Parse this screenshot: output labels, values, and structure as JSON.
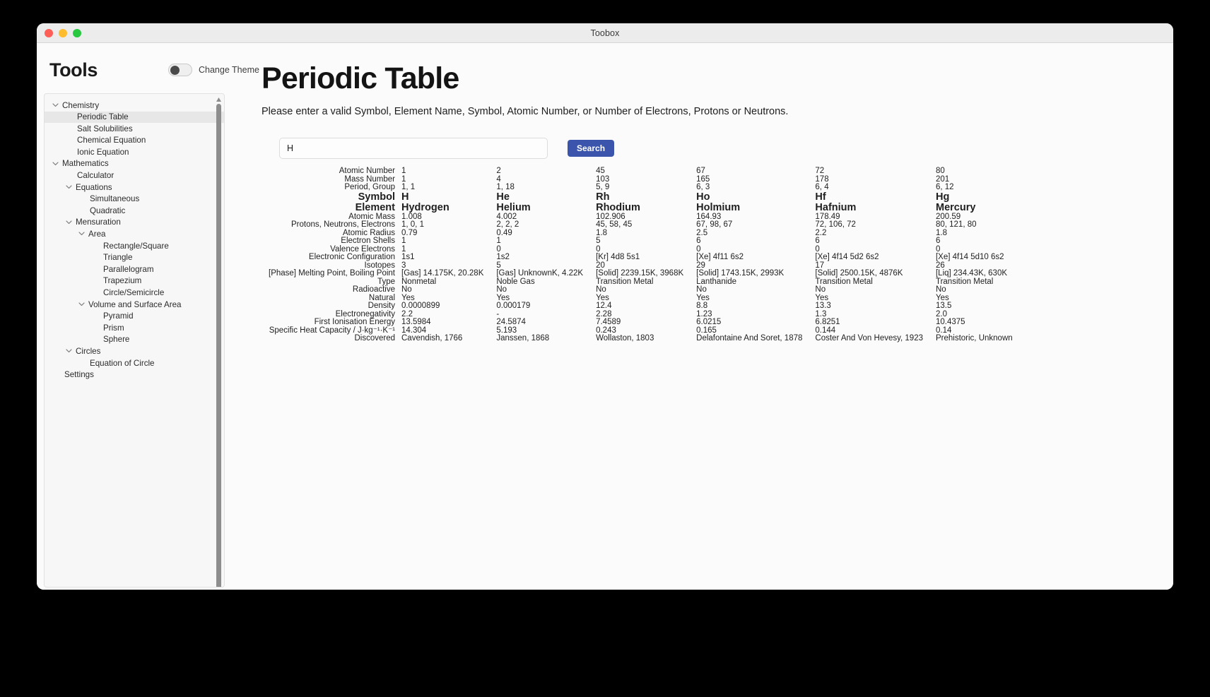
{
  "window": {
    "title": "Toobox"
  },
  "sidebar": {
    "heading": "Tools",
    "theme_label": "Change Theme",
    "tree": [
      {
        "label": "Chemistry",
        "depth": 0,
        "chevron": true,
        "selected": false
      },
      {
        "label": "Periodic Table",
        "depth": 1,
        "chevron": false,
        "selected": true
      },
      {
        "label": "Salt Solubilities",
        "depth": 1,
        "chevron": false,
        "selected": false
      },
      {
        "label": "Chemical Equation",
        "depth": 1,
        "chevron": false,
        "selected": false
      },
      {
        "label": "Ionic Equation",
        "depth": 1,
        "chevron": false,
        "selected": false
      },
      {
        "label": "Mathematics",
        "depth": 0,
        "chevron": true,
        "selected": false
      },
      {
        "label": "Calculator",
        "depth": 1,
        "chevron": false,
        "selected": false
      },
      {
        "label": "Equations",
        "depth": 1,
        "chevron": true,
        "selected": false
      },
      {
        "label": "Simultaneous",
        "depth": 2,
        "chevron": false,
        "selected": false
      },
      {
        "label": "Quadratic",
        "depth": 2,
        "chevron": false,
        "selected": false
      },
      {
        "label": "Mensuration",
        "depth": 1,
        "chevron": true,
        "selected": false
      },
      {
        "label": "Area",
        "depth": 2,
        "chevron": true,
        "selected": false
      },
      {
        "label": "Rectangle/Square",
        "depth": 3,
        "chevron": false,
        "selected": false
      },
      {
        "label": "Triangle",
        "depth": 3,
        "chevron": false,
        "selected": false
      },
      {
        "label": "Parallelogram",
        "depth": 3,
        "chevron": false,
        "selected": false
      },
      {
        "label": "Trapezium",
        "depth": 3,
        "chevron": false,
        "selected": false
      },
      {
        "label": "Circle/Semicircle",
        "depth": 3,
        "chevron": false,
        "selected": false
      },
      {
        "label": "Volume and Surface Area",
        "depth": 2,
        "chevron": true,
        "selected": false
      },
      {
        "label": "Pyramid",
        "depth": 3,
        "chevron": false,
        "selected": false
      },
      {
        "label": "Prism",
        "depth": 3,
        "chevron": false,
        "selected": false
      },
      {
        "label": "Sphere",
        "depth": 3,
        "chevron": false,
        "selected": false
      },
      {
        "label": "Circles",
        "depth": 1,
        "chevron": true,
        "selected": false
      },
      {
        "label": "Equation of Circle",
        "depth": 2,
        "chevron": false,
        "selected": false
      },
      {
        "label": "Settings",
        "depth": 0,
        "chevron": false,
        "selected": false
      }
    ]
  },
  "main": {
    "title": "Periodic Table",
    "subtitle": "Please enter a valid Symbol, Element Name, Symbol, Atomic Number, or Number of Electrons, Protons or Neutrons.",
    "search_value": "H",
    "search_placeholder": "",
    "search_button": "Search",
    "accent_color": "#3b55ad"
  },
  "table": {
    "row_labels": [
      "Atomic Number",
      "Mass Number",
      "Period, Group",
      "Symbol",
      "Element",
      "Atomic Mass",
      "Protons, Neutrons, Electrons",
      "Atomic Radius",
      "Electron Shells",
      "Valence Electrons",
      "Electronic Configuration",
      "Isotopes",
      "[Phase] Melting Point, Boiling Point",
      "Type",
      "Radioactive",
      "Natural",
      "Density",
      "Electronegativity",
      "First Ionisation Energy",
      "Specific Heat Capacity / J·kg⁻¹·K⁻¹",
      "Discovered"
    ],
    "big_rows": [
      3,
      4
    ],
    "columns": [
      {
        "atomic_number": "1",
        "mass_number": "1",
        "period_group": "1, 1",
        "symbol": "H",
        "element": "Hydrogen",
        "atomic_mass": "1.008",
        "pne": "1, 0, 1",
        "atomic_radius": "0.79",
        "electron_shells": "1",
        "valence_electrons": "1",
        "configuration": "1s1",
        "isotopes": "3",
        "phase_points": "[Gas] 14.175K, 20.28K",
        "type": "Nonmetal",
        "radioactive": "No",
        "natural": "Yes",
        "density": "0.0000899",
        "electronegativity": "2.2",
        "first_ionisation": "13.5984",
        "specific_heat": "14.304",
        "discovered": "Cavendish, 1766"
      },
      {
        "atomic_number": "2",
        "mass_number": "4",
        "period_group": "1, 18",
        "symbol": "He",
        "element": "Helium",
        "atomic_mass": "4.002",
        "pne": "2, 2, 2",
        "atomic_radius": "0.49",
        "electron_shells": "1",
        "valence_electrons": "0",
        "configuration": "1s2",
        "isotopes": "5",
        "phase_points": "[Gas] UnknownK, 4.22K",
        "type": "Noble Gas",
        "radioactive": "No",
        "natural": "Yes",
        "density": "0.000179",
        "electronegativity": "-",
        "first_ionisation": "24.5874",
        "specific_heat": "5.193",
        "discovered": "Janssen, 1868"
      },
      {
        "atomic_number": "45",
        "mass_number": "103",
        "period_group": "5, 9",
        "symbol": "Rh",
        "element": "Rhodium",
        "atomic_mass": "102.906",
        "pne": "45, 58, 45",
        "atomic_radius": "1.8",
        "electron_shells": "5",
        "valence_electrons": "0",
        "configuration": "[Kr] 4d8 5s1",
        "isotopes": "20",
        "phase_points": "[Solid] 2239.15K, 3968K",
        "type": "Transition Metal",
        "radioactive": "No",
        "natural": "Yes",
        "density": "12.4",
        "electronegativity": "2.28",
        "first_ionisation": "7.4589",
        "specific_heat": "0.243",
        "discovered": "Wollaston, 1803"
      },
      {
        "atomic_number": "67",
        "mass_number": "165",
        "period_group": "6, 3",
        "symbol": "Ho",
        "element": "Holmium",
        "atomic_mass": "164.93",
        "pne": "67, 98, 67",
        "atomic_radius": "2.5",
        "electron_shells": "6",
        "valence_electrons": "0",
        "configuration": "[Xe] 4f11 6s2",
        "isotopes": "29",
        "phase_points": "[Solid] 1743.15K, 2993K",
        "type": "Lanthanide",
        "radioactive": "No",
        "natural": "Yes",
        "density": "8.8",
        "electronegativity": "1.23",
        "first_ionisation": "6.0215",
        "specific_heat": "0.165",
        "discovered": "Delafontaine And Soret, 1878"
      },
      {
        "atomic_number": "72",
        "mass_number": "178",
        "period_group": "6, 4",
        "symbol": "Hf",
        "element": "Hafnium",
        "atomic_mass": "178.49",
        "pne": "72, 106, 72",
        "atomic_radius": "2.2",
        "electron_shells": "6",
        "valence_electrons": "0",
        "configuration": "[Xe] 4f14 5d2 6s2",
        "isotopes": "17",
        "phase_points": "[Solid] 2500.15K, 4876K",
        "type": "Transition Metal",
        "radioactive": "No",
        "natural": "Yes",
        "density": "13.3",
        "electronegativity": "1.3",
        "first_ionisation": "6.8251",
        "specific_heat": "0.144",
        "discovered": "Coster And Von Hevesy, 1923"
      },
      {
        "atomic_number": "80",
        "mass_number": "201",
        "period_group": "6, 12",
        "symbol": "Hg",
        "element": "Mercury",
        "atomic_mass": "200.59",
        "pne": "80, 121, 80",
        "atomic_radius": "1.8",
        "electron_shells": "6",
        "valence_electrons": "0",
        "configuration": "[Xe] 4f14 5d10 6s2",
        "isotopes": "26",
        "phase_points": "[Liq] 234.43K, 630K",
        "type": "Transition Metal",
        "radioactive": "No",
        "natural": "Yes",
        "density": "13.5",
        "electronegativity": "2.0",
        "first_ionisation": "10.4375",
        "specific_heat": "0.14",
        "discovered": "Prehistoric, Unknown"
      }
    ],
    "field_order": [
      "atomic_number",
      "mass_number",
      "period_group",
      "symbol",
      "element",
      "atomic_mass",
      "pne",
      "atomic_radius",
      "electron_shells",
      "valence_electrons",
      "configuration",
      "isotopes",
      "phase_points",
      "type",
      "radioactive",
      "natural",
      "density",
      "electronegativity",
      "first_ionisation",
      "specific_heat",
      "discovered"
    ]
  }
}
